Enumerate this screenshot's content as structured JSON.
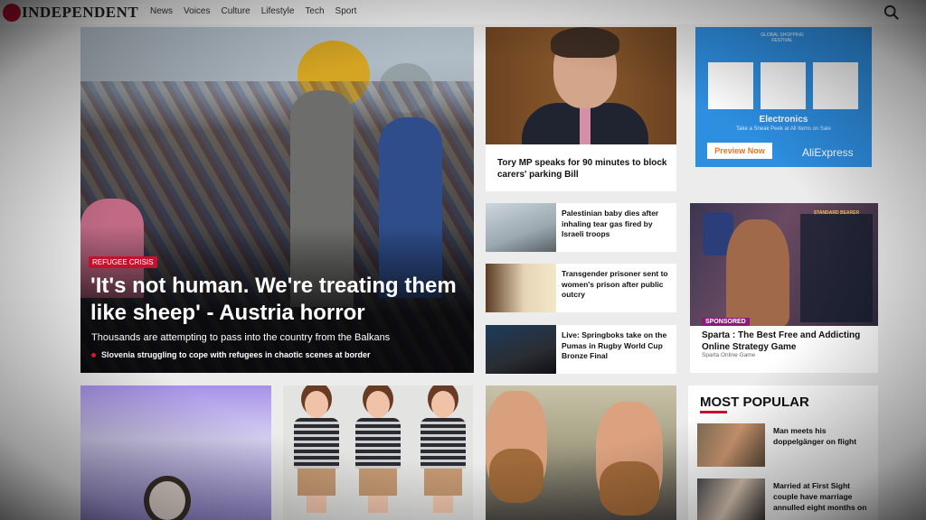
{
  "nav": {
    "logo_text": "INDEPENDENT",
    "items": [
      "News",
      "Voices",
      "Culture",
      "Lifestyle",
      "Tech",
      "Sport"
    ]
  },
  "hero": {
    "tag": "REFUGEE CRISIS",
    "title": "'It's not human. We're treating them like sheep' - Austria horror",
    "subtitle": "Thousands are attempting to pass into the country from the Balkans",
    "related": "Slovenia struggling to cope with refugees in chaotic scenes at border"
  },
  "mp_card": {
    "title": "Tory MP speaks for 90 minutes to block carers' parking Bill"
  },
  "small_cards": [
    {
      "title": "Palestinian baby dies after inhaling tear gas fired by Israeli troops"
    },
    {
      "title": "Transgender prisoner sent to women's prison after public outcry"
    },
    {
      "title": "Live: Springboks take on the Pumas in Rugby World Cup Bronze Final"
    }
  ],
  "ad_aliexpress": {
    "festival": "GLOBAL SHOPPING FESTIVAL",
    "category": "Electronics",
    "sneak": "Take a Sneak Peek at All Items on Sale",
    "button": "Preview Now",
    "brand": "AliExpress"
  },
  "ad_sparta": {
    "panel_title": "STANDARD BEARER",
    "label": "SPONSORED",
    "title": "Sparta : The Best Free and Addicting Online Strategy Game",
    "source": "Sparta Online Game"
  },
  "most_popular": {
    "heading": "MOST POPULAR",
    "items": [
      {
        "title": "Man meets his doppelgänger on flight"
      },
      {
        "title": "Married at First Sight couple have marriage annulled eight months on"
      }
    ]
  },
  "colors": {
    "brand_red": "#c8102e",
    "ad_blue": "#2e8ee0",
    "sponsored_purple": "#8b1a7a",
    "cta_orange": "#e8731e"
  }
}
